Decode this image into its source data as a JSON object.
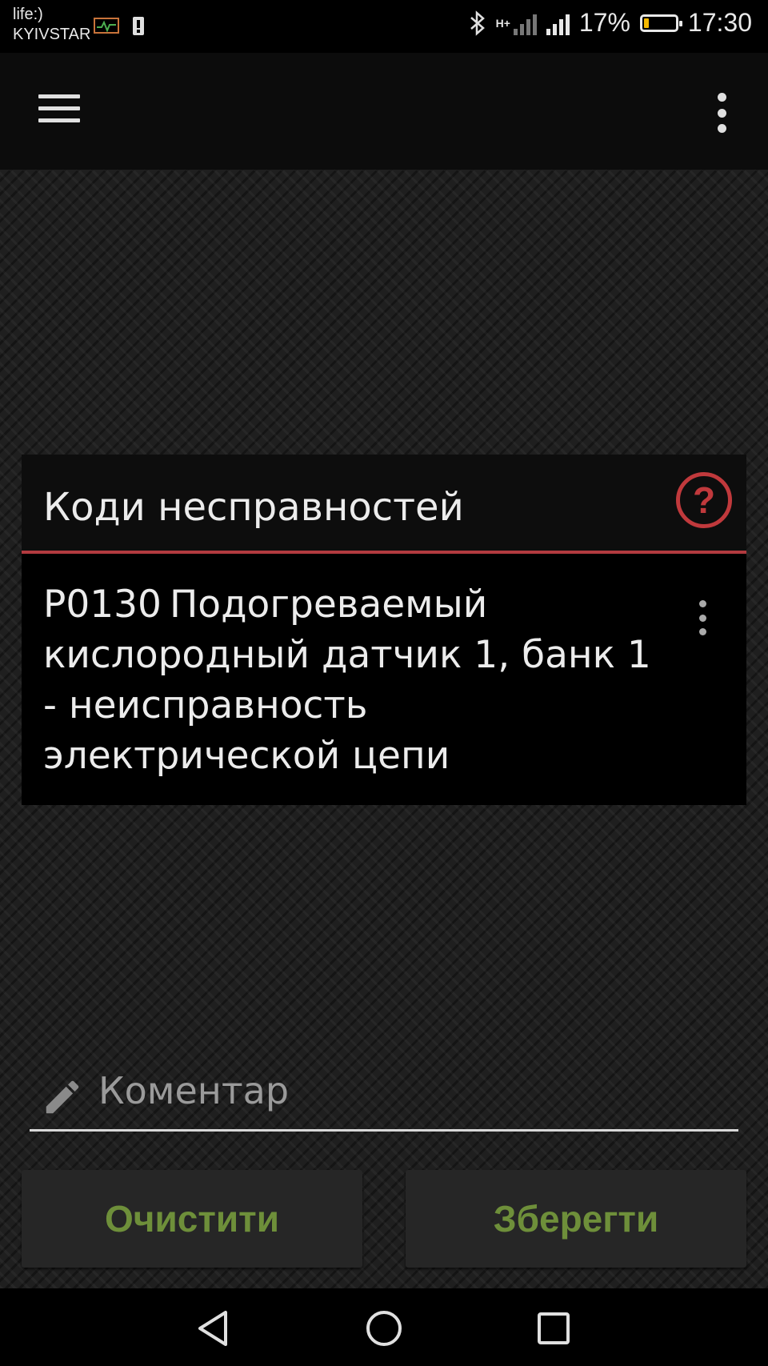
{
  "status_bar": {
    "carrier_line1": "life:)",
    "carrier_line2": "KYIVSTAR",
    "network_label": "H+",
    "battery_text": "17%",
    "battery_level": 0.17,
    "time": "17:30",
    "icons": [
      "monitor-icon",
      "notification-icon",
      "bluetooth-icon",
      "signal-icon",
      "battery-icon"
    ]
  },
  "app_bar": {
    "menu_icon": "hamburger-menu-icon",
    "overflow_icon": "more-vert-icon"
  },
  "codes_card": {
    "title": "Коди несправностей",
    "help_label": "?",
    "items": [
      {
        "code": "P0130",
        "description": "Подогреваемый кислородный датчик 1, банк 1 - неисправность электрической цепи"
      }
    ]
  },
  "comment": {
    "placeholder": "Коментар",
    "value": "",
    "icon": "pencil-icon"
  },
  "buttons": {
    "clear": "Очистити",
    "save": "Зберегти"
  },
  "colors": {
    "accent_red": "#c0393c",
    "button_text_green": "#6e8f3a",
    "battery_fill": "#f5b800"
  },
  "nav_bar": {
    "icons": [
      "back-icon",
      "home-icon",
      "recent-apps-icon"
    ]
  }
}
